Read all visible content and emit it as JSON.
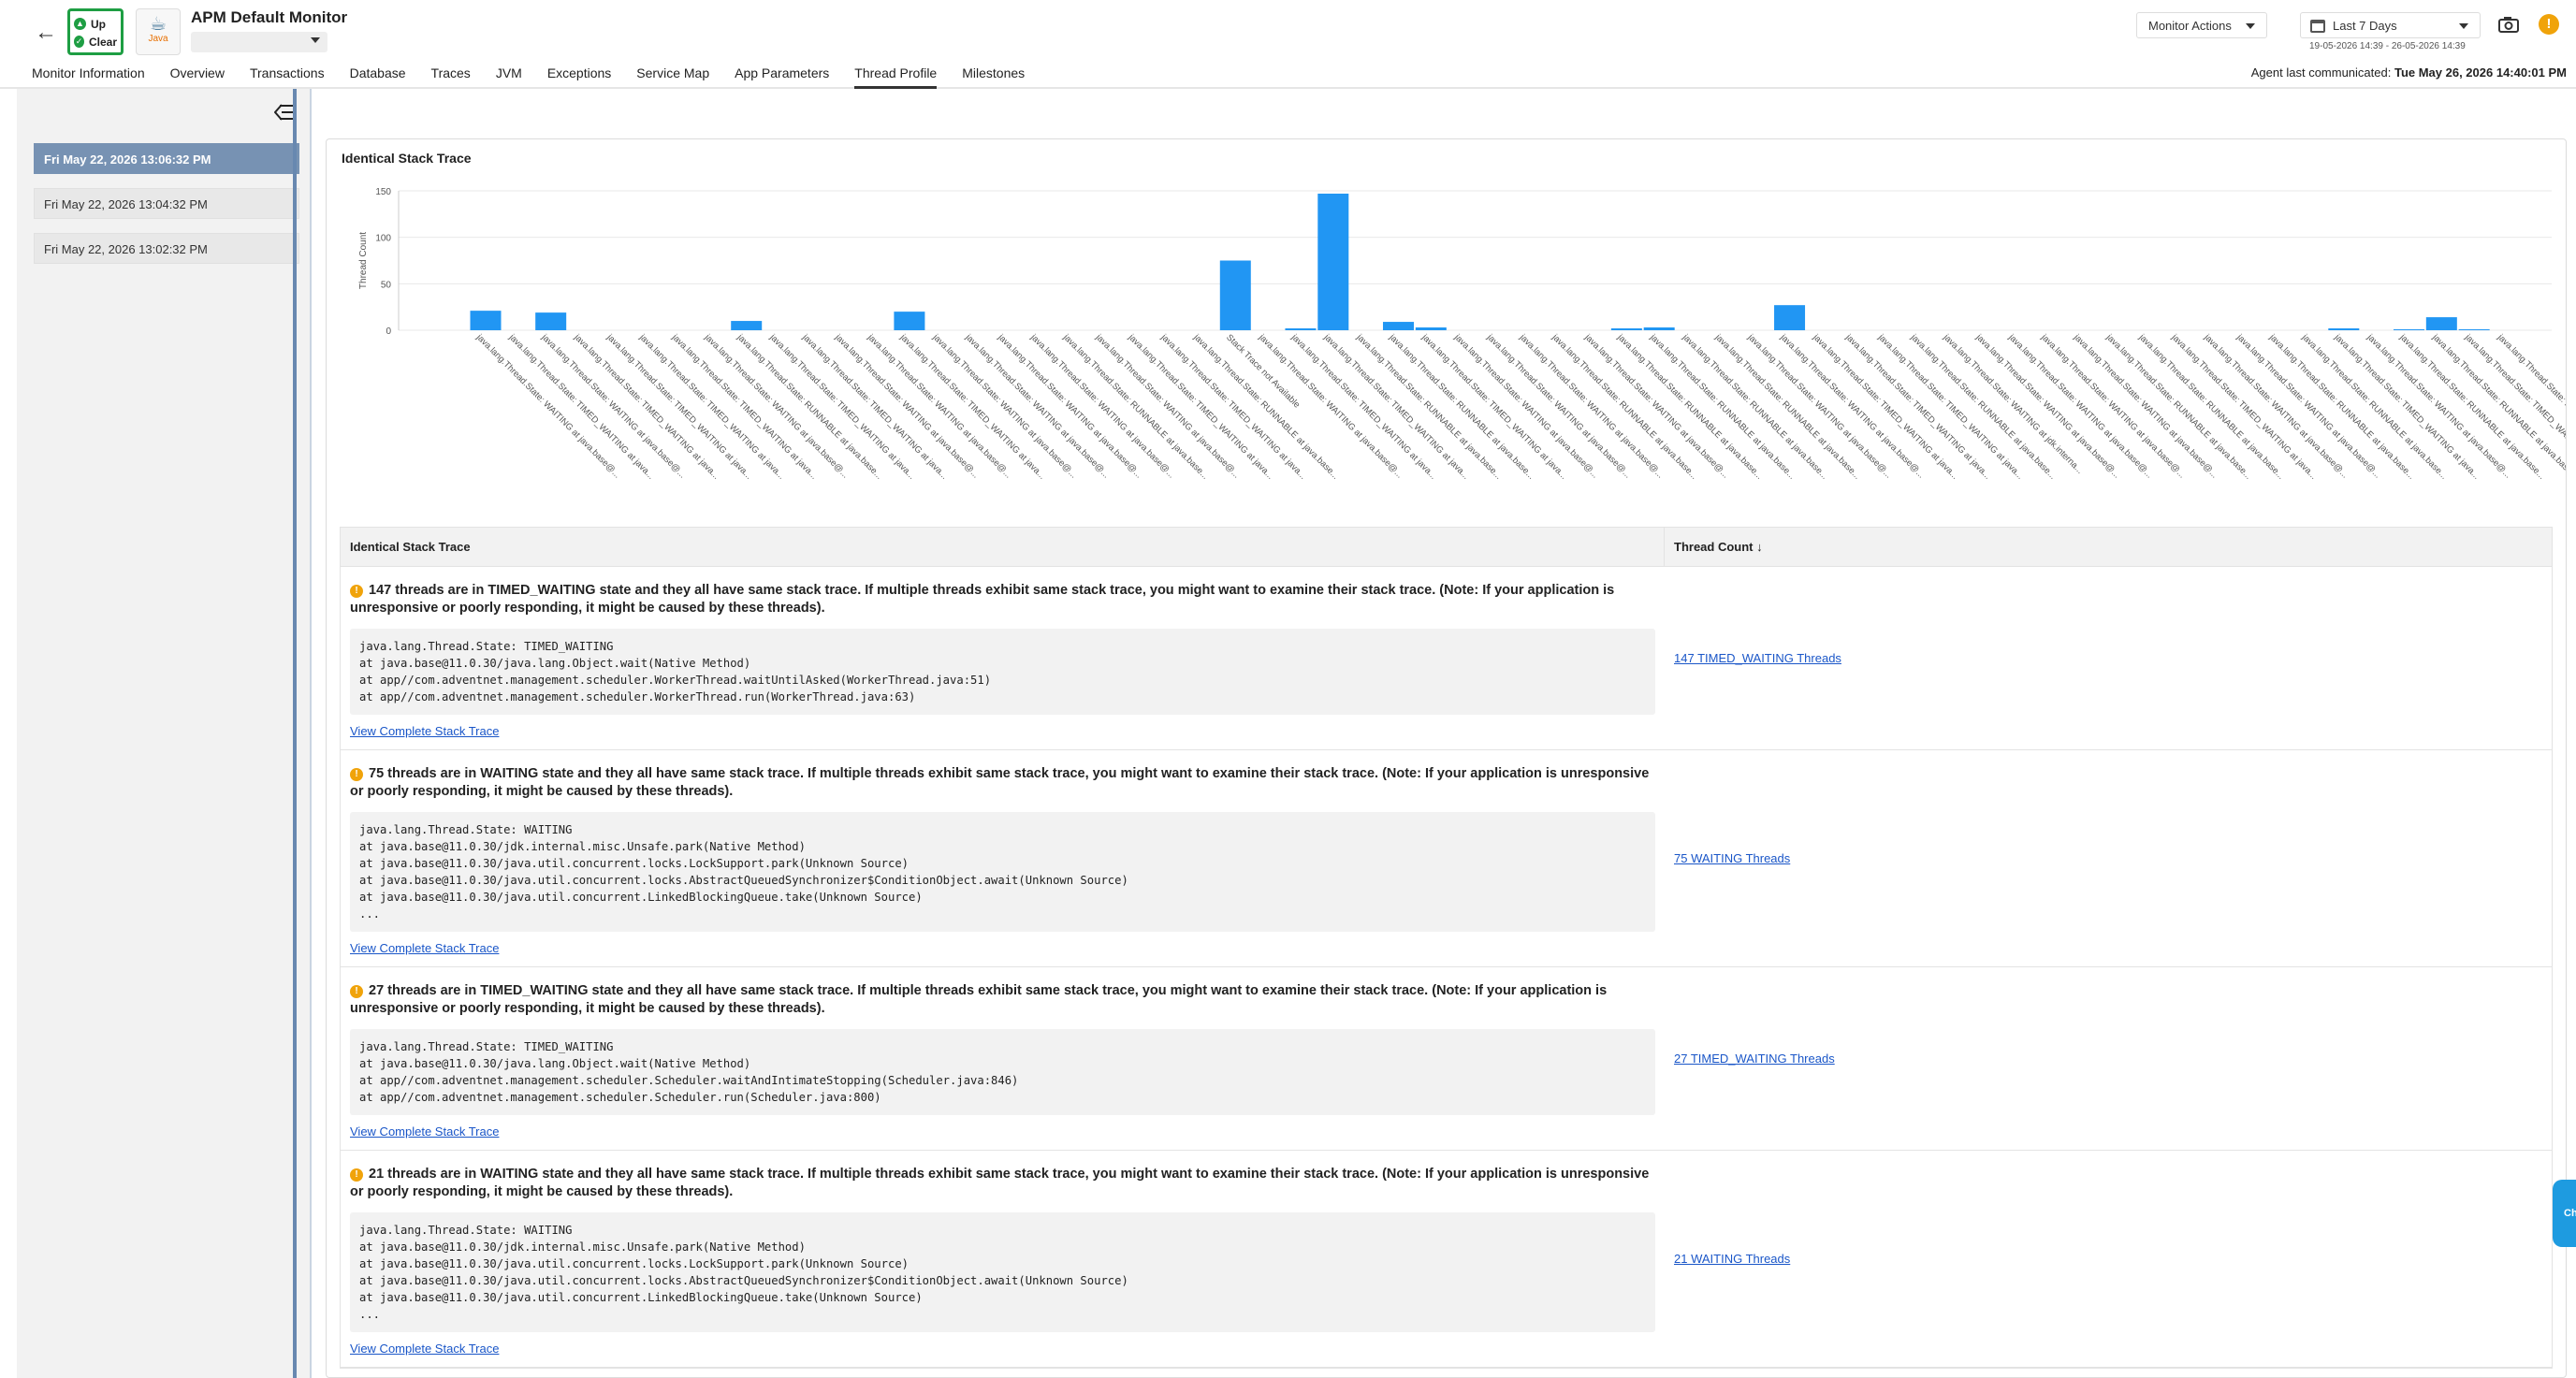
{
  "header": {
    "back_icon": "arrow-left-icon",
    "status_up": "Up",
    "status_clear": "Clear",
    "logo_text": "Java",
    "monitor_title": "APM Default Monitor",
    "monitor_actions": "Monitor Actions",
    "period": "Last 7 Days",
    "daterange": "19-05-2026 14:39 - 26-05-2026 14:39",
    "agent_label": "Agent last communicated:",
    "agent_time": "Tue May 26, 2026 14:40:01 PM",
    "colors": {
      "status_green": "#1e9e43",
      "alert": "#f0a30a",
      "link": "#1a56c8",
      "bar": "#2196f3"
    }
  },
  "tabs": [
    {
      "label": "Monitor Information"
    },
    {
      "label": "Overview"
    },
    {
      "label": "Transactions"
    },
    {
      "label": "Database"
    },
    {
      "label": "Traces"
    },
    {
      "label": "JVM"
    },
    {
      "label": "Exceptions"
    },
    {
      "label": "Service Map"
    },
    {
      "label": "App Parameters"
    },
    {
      "label": "Thread Profile",
      "active": true
    },
    {
      "label": "Milestones"
    }
  ],
  "sidebar": {
    "snapshots": [
      {
        "label": "Fri May 22, 2026 13:06:32 PM",
        "active": true
      },
      {
        "label": "Fri May 22, 2026 13:04:32 PM"
      },
      {
        "label": "Fri May 22, 2026 13:02:32 PM"
      }
    ]
  },
  "chart_data": {
    "type": "bar",
    "title": "Identical Stack Trace",
    "ylabel": "Thread Count",
    "xlabel": "",
    "ylim": [
      0,
      150
    ],
    "yticks": [
      0,
      50,
      100,
      150
    ],
    "grid": true,
    "categories": [
      "java.lang.Thread.State: WAITING\\nat java.base@...",
      "java.lang.Thread.State: TIMED_WAITING\\nat java...",
      "java.lang.Thread.State: WAITING\\nat java.base@...",
      "java.lang.Thread.State: TIMED_WAITING\\nat java...",
      "java.lang.Thread.State: TIMED_WAITING\\nat java...",
      "java.lang.Thread.State: TIMED_WAITING\\nat java...",
      "java.lang.Thread.State: TIMED_WAITING\\nat java...",
      "java.lang.Thread.State: WAITING\\nat java.base@...",
      "java.lang.Thread.State: RUNNABLE\\nat java.base...",
      "java.lang.Thread.State: TIMED_WAITING\\nat java...",
      "java.lang.Thread.State: TIMED_WAITING\\nat java...",
      "java.lang.Thread.State: WAITING\\nat java.base@...",
      "java.lang.Thread.State: WAITING\\nat java.base@...",
      "java.lang.Thread.State: TIMED_WAITING\\nat java...",
      "java.lang.Thread.State: WAITING\\nat java.base@...",
      "java.lang.Thread.State: WAITING\\nat java.base@...",
      "java.lang.Thread.State: WAITING\\nat java.base@...",
      "java.lang.Thread.State: WAITING\\nat java.base@...",
      "java.lang.Thread.State: RUNNABLE\\nat java.base...",
      "java.lang.Thread.State: WAITING\\nat java.base@...",
      "java.lang.Thread.State: TIMED_WAITING\\nat java...",
      "java.lang.Thread.State: TIMED_WAITING\\nat java...",
      "java.lang.Thread.State: RUNNABLE\\nat java.base...",
      "Stack Trace not Available",
      "java.lang.Thread.State: WAITING\\nat java.base@...",
      "java.lang.Thread.State: TIMED_WAITING\\nat java...",
      "java.lang.Thread.State: TIMED_WAITING\\nat java...",
      "java.lang.Thread.State: RUNNABLE\\nat java.base...",
      "java.lang.Thread.State: RUNNABLE\\nat java.base...",
      "java.lang.Thread.State: TIMED_WAITING\\nat java...",
      "java.lang.Thread.State: WAITING\\nat java.base@...",
      "java.lang.Thread.State: WAITING\\nat java.base@...",
      "java.lang.Thread.State: WAITING\\nat java.base@...",
      "java.lang.Thread.State: RUNNABLE\\nat java.base...",
      "java.lang.Thread.State: WAITING\\nat java.base@...",
      "java.lang.Thread.State: RUNNABLE\\nat java.base...",
      "java.lang.Thread.State: RUNNABLE\\nat java.base...",
      "java.lang.Thread.State: RUNNABLE\\nat java.base...",
      "java.lang.Thread.State: RUNNABLE\\nat java.base...",
      "java.lang.Thread.State: WAITING\\nat java.base@...",
      "java.lang.Thread.State: WAITING\\nat java.base@...",
      "java.lang.Thread.State: TIMED_WAITING\\nat java...",
      "java.lang.Thread.State: TIMED_WAITING\\nat java...",
      "java.lang.Thread.State: TIMED_WAITING\\nat java...",
      "java.lang.Thread.State: RUNNABLE\\nat java.base...",
      "java.lang.Thread.State: WAITING\\nat jdk.interna...",
      "java.lang.Thread.State: WAITING\\nat java.base@...",
      "java.lang.Thread.State: WAITING\\nat java.base@...",
      "java.lang.Thread.State: WAITING\\nat java.base@...",
      "java.lang.Thread.State: WAITING\\nat java.base@...",
      "java.lang.Thread.State: RUNNABLE\\nat java.base...",
      "java.lang.Thread.State: RUNNABLE\\nat java.base...",
      "java.lang.Thread.State: TIMED_WAITING\\nat java...",
      "java.lang.Thread.State: WAITING\\nat java.base@...",
      "java.lang.Thread.State: WAITING\\nat java.base@...",
      "java.lang.Thread.State: RUNNABLE\\nat java.base...",
      "java.lang.Thread.State: RUNNABLE\\nat java.base...",
      "java.lang.Thread.State: TIMED_WAITING\\nat java...",
      "java.lang.Thread.State: WAITING\\nat java.base@...",
      "java.lang.Thread.State: RUNNABLE\\nat java.base...",
      "java.lang.Thread.State: RUNNABLE\\nat java.base...",
      "java.lang.Thread.State: TIMED_WAITING\\nat java...",
      "java.lang.Thread.State: RUNNABL..."
    ],
    "values": [
      21,
      0,
      19,
      0,
      0,
      0,
      0,
      0,
      10,
      0,
      0,
      0,
      0,
      20,
      0,
      0,
      0,
      0,
      0,
      0,
      0,
      0,
      0,
      75,
      0,
      2,
      147,
      0,
      9,
      3,
      0,
      0,
      0,
      0,
      0,
      2,
      3,
      0,
      0,
      0,
      27,
      0,
      0,
      0,
      0,
      0,
      0,
      0,
      0,
      0,
      0,
      0,
      0,
      0,
      0,
      0,
      0,
      2,
      0,
      1,
      14,
      1,
      0
    ]
  },
  "table": {
    "col1": "Identical Stack Trace",
    "col2": "Thread Count",
    "view_link": "View Complete Stack Trace",
    "rows": [
      {
        "message": "147 threads are in TIMED_WAITING state and they all have same stack trace. If multiple threads exhibit same stack trace, you might want to examine their stack trace. (Note: If your application is unresponsive or poorly responding, it might be caused by these threads).",
        "trace": "java.lang.Thread.State: TIMED_WAITING\nat java.base@11.0.30/java.lang.Object.wait(Native Method)\nat app//com.adventnet.management.scheduler.WorkerThread.waitUntilAsked(WorkerThread.java:51)\nat app//com.adventnet.management.scheduler.WorkerThread.run(WorkerThread.java:63)",
        "count_link": "147 TIMED_WAITING Threads"
      },
      {
        "message": "75 threads are in WAITING state and they all have same stack trace. If multiple threads exhibit same stack trace, you might want to examine their stack trace. (Note: If your application is unresponsive or poorly responding, it might be caused by these threads).",
        "trace": "java.lang.Thread.State: WAITING\nat java.base@11.0.30/jdk.internal.misc.Unsafe.park(Native Method)\nat java.base@11.0.30/java.util.concurrent.locks.LockSupport.park(Unknown Source)\nat java.base@11.0.30/java.util.concurrent.locks.AbstractQueuedSynchronizer$ConditionObject.await(Unknown Source)\nat java.base@11.0.30/java.util.concurrent.LinkedBlockingQueue.take(Unknown Source)\n...",
        "count_link": "75 WAITING Threads"
      },
      {
        "message": "27 threads are in TIMED_WAITING state and they all have same stack trace. If multiple threads exhibit same stack trace, you might want to examine their stack trace. (Note: If your application is unresponsive or poorly responding, it might be caused by these threads).",
        "trace": "java.lang.Thread.State: TIMED_WAITING\nat java.base@11.0.30/java.lang.Object.wait(Native Method)\nat app//com.adventnet.management.scheduler.Scheduler.waitAndIntimateStopping(Scheduler.java:846)\nat app//com.adventnet.management.scheduler.Scheduler.run(Scheduler.java:800)",
        "count_link": "27 TIMED_WAITING Threads"
      },
      {
        "message": "21 threads are in WAITING state and they all have same stack trace. If multiple threads exhibit same stack trace, you might want to examine their stack trace. (Note: If your application is unresponsive or poorly responding, it might be caused by these threads).",
        "trace": "java.lang.Thread.State: WAITING\nat java.base@11.0.30/jdk.internal.misc.Unsafe.park(Native Method)\nat java.base@11.0.30/java.util.concurrent.locks.LockSupport.park(Unknown Source)\nat java.base@11.0.30/java.util.concurrent.locks.AbstractQueuedSynchronizer$ConditionObject.await(Unknown Source)\nat java.base@11.0.30/java.util.concurrent.LinkedBlockingQueue.take(Unknown Source)\n...",
        "count_link": "21 WAITING Threads"
      }
    ]
  },
  "chat_label": "Ch"
}
